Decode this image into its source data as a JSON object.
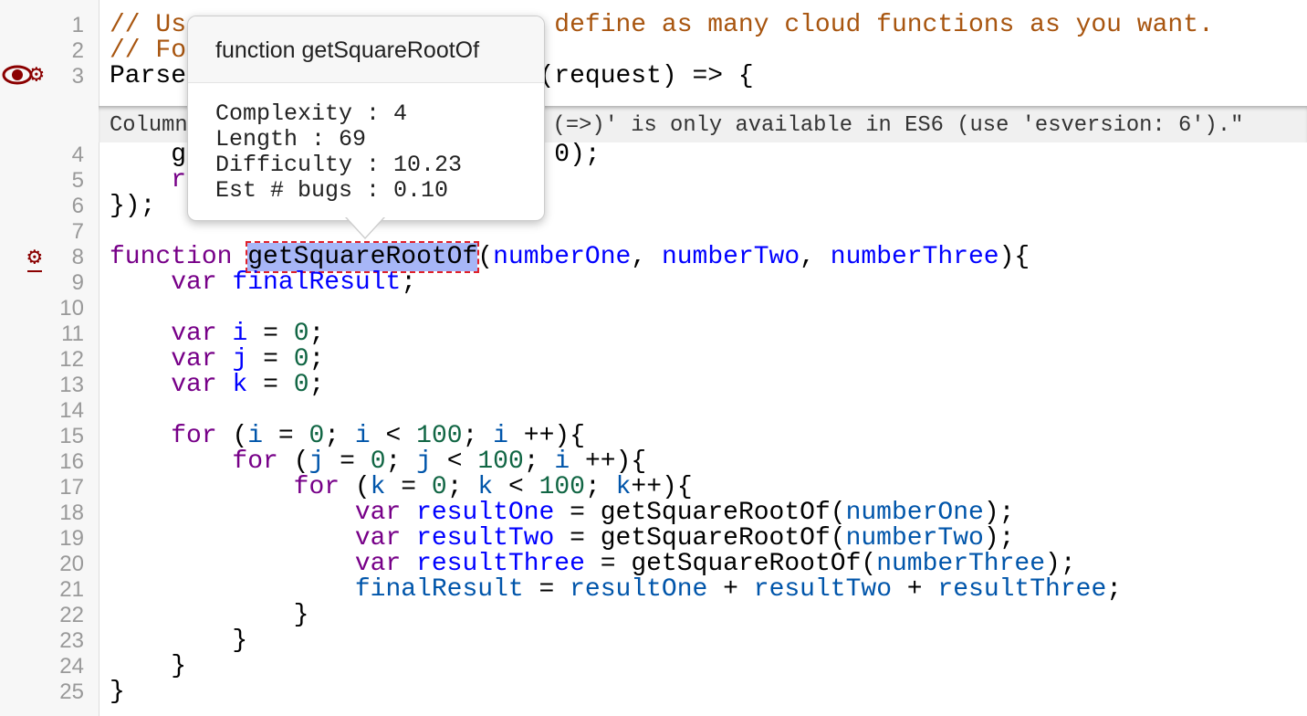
{
  "editor": {
    "line_numbers": [
      "1",
      "2",
      "3",
      "4",
      "5",
      "6",
      "7",
      "8",
      "9",
      "10",
      "11",
      "12",
      "13",
      "14",
      "15",
      "16",
      "17",
      "18",
      "19",
      "20",
      "21",
      "22",
      "23",
      "24",
      "25"
    ],
    "lines": [
      [
        [
          "// Us                        define as many cloud functions as you want.",
          "comment"
        ]
      ],
      [
        [
          "// Fo",
          "comment"
        ]
      ],
      [
        [
          "Parse                       (request) => {",
          "plain"
        ]
      ],
      [
        [
          "    ge                       0);",
          "plain"
        ]
      ],
      [
        [
          "    re",
          "keyword"
        ]
      ],
      [
        [
          "});",
          "plain"
        ]
      ],
      [],
      [
        [
          "function",
          "keyword"
        ],
        [
          " ",
          "plain"
        ],
        [
          "getSquareRootOf",
          "hl"
        ],
        [
          "(",
          "plain"
        ],
        [
          "numberOne",
          "def"
        ],
        [
          ", ",
          "plain"
        ],
        [
          "numberTwo",
          "def"
        ],
        [
          ", ",
          "plain"
        ],
        [
          "numberThree",
          "def"
        ],
        [
          "){",
          "plain"
        ]
      ],
      [
        [
          "    ",
          "plain"
        ],
        [
          "var",
          "keyword"
        ],
        [
          " ",
          "plain"
        ],
        [
          "finalResult",
          "def"
        ],
        [
          ";",
          "plain"
        ]
      ],
      [],
      [
        [
          "    ",
          "plain"
        ],
        [
          "var",
          "keyword"
        ],
        [
          " ",
          "plain"
        ],
        [
          "i",
          "def"
        ],
        [
          " = ",
          "plain"
        ],
        [
          "0",
          "number"
        ],
        [
          ";",
          "plain"
        ]
      ],
      [
        [
          "    ",
          "plain"
        ],
        [
          "var",
          "keyword"
        ],
        [
          " ",
          "plain"
        ],
        [
          "j",
          "def"
        ],
        [
          " = ",
          "plain"
        ],
        [
          "0",
          "number"
        ],
        [
          ";",
          "plain"
        ]
      ],
      [
        [
          "    ",
          "plain"
        ],
        [
          "var",
          "keyword"
        ],
        [
          " ",
          "plain"
        ],
        [
          "k",
          "def"
        ],
        [
          " = ",
          "plain"
        ],
        [
          "0",
          "number"
        ],
        [
          ";",
          "plain"
        ]
      ],
      [],
      [
        [
          "    ",
          "plain"
        ],
        [
          "for",
          "keyword"
        ],
        [
          " (",
          "plain"
        ],
        [
          "i",
          "var2"
        ],
        [
          " = ",
          "plain"
        ],
        [
          "0",
          "number"
        ],
        [
          "; ",
          "plain"
        ],
        [
          "i",
          "var2"
        ],
        [
          " < ",
          "plain"
        ],
        [
          "100",
          "number"
        ],
        [
          "; ",
          "plain"
        ],
        [
          "i",
          "var2"
        ],
        [
          " ++){",
          "plain"
        ]
      ],
      [
        [
          "        ",
          "plain"
        ],
        [
          "for",
          "keyword"
        ],
        [
          " (",
          "plain"
        ],
        [
          "j",
          "var2"
        ],
        [
          " = ",
          "plain"
        ],
        [
          "0",
          "number"
        ],
        [
          "; ",
          "plain"
        ],
        [
          "j",
          "var2"
        ],
        [
          " < ",
          "plain"
        ],
        [
          "100",
          "number"
        ],
        [
          "; ",
          "plain"
        ],
        [
          "i",
          "var2"
        ],
        [
          " ++){",
          "plain"
        ]
      ],
      [
        [
          "            ",
          "plain"
        ],
        [
          "for",
          "keyword"
        ],
        [
          " (",
          "plain"
        ],
        [
          "k",
          "var2"
        ],
        [
          " = ",
          "plain"
        ],
        [
          "0",
          "number"
        ],
        [
          "; ",
          "plain"
        ],
        [
          "k",
          "var2"
        ],
        [
          " < ",
          "plain"
        ],
        [
          "100",
          "number"
        ],
        [
          "; ",
          "plain"
        ],
        [
          "k",
          "var2"
        ],
        [
          "++){",
          "plain"
        ]
      ],
      [
        [
          "                ",
          "plain"
        ],
        [
          "var",
          "keyword"
        ],
        [
          " ",
          "plain"
        ],
        [
          "resultOne",
          "def"
        ],
        [
          " = getSquareRootOf(",
          "plain"
        ],
        [
          "numberOne",
          "var2"
        ],
        [
          ");",
          "plain"
        ]
      ],
      [
        [
          "                ",
          "plain"
        ],
        [
          "var",
          "keyword"
        ],
        [
          " ",
          "plain"
        ],
        [
          "resultTwo",
          "def"
        ],
        [
          " = getSquareRootOf(",
          "plain"
        ],
        [
          "numberTwo",
          "var2"
        ],
        [
          ");",
          "plain"
        ]
      ],
      [
        [
          "                ",
          "plain"
        ],
        [
          "var",
          "keyword"
        ],
        [
          " ",
          "plain"
        ],
        [
          "resultThree",
          "def"
        ],
        [
          " = getSquareRootOf(",
          "plain"
        ],
        [
          "numberThree",
          "var2"
        ],
        [
          ");",
          "plain"
        ]
      ],
      [
        [
          "                ",
          "plain"
        ],
        [
          "finalResult",
          "var2"
        ],
        [
          " = ",
          "plain"
        ],
        [
          "resultOne",
          "var2"
        ],
        [
          " + ",
          "plain"
        ],
        [
          "resultTwo",
          "var2"
        ],
        [
          " + ",
          "plain"
        ],
        [
          "resultThree",
          "var2"
        ],
        [
          ";",
          "plain"
        ]
      ],
      [
        [
          "            }",
          "plain"
        ]
      ],
      [
        [
          "        }",
          "plain"
        ]
      ],
      [
        [
          "    }",
          "plain"
        ]
      ],
      [
        [
          "}",
          "plain"
        ]
      ]
    ]
  },
  "lint_widget": {
    "text": "Column                          x (=>)' is only available in ES6 (use 'esversion: 6').\""
  },
  "gutter_icons": {
    "line3": [
      "eye-icon",
      "gear-icon"
    ],
    "line8": [
      "gear-icon"
    ],
    "color": "#8b0000"
  },
  "tooltip": {
    "title": "function getSquareRootOf",
    "rows": [
      "Complexity : 4",
      "Length : 69",
      "Difficulty : 10.23",
      "Est # bugs : 0.10"
    ]
  }
}
